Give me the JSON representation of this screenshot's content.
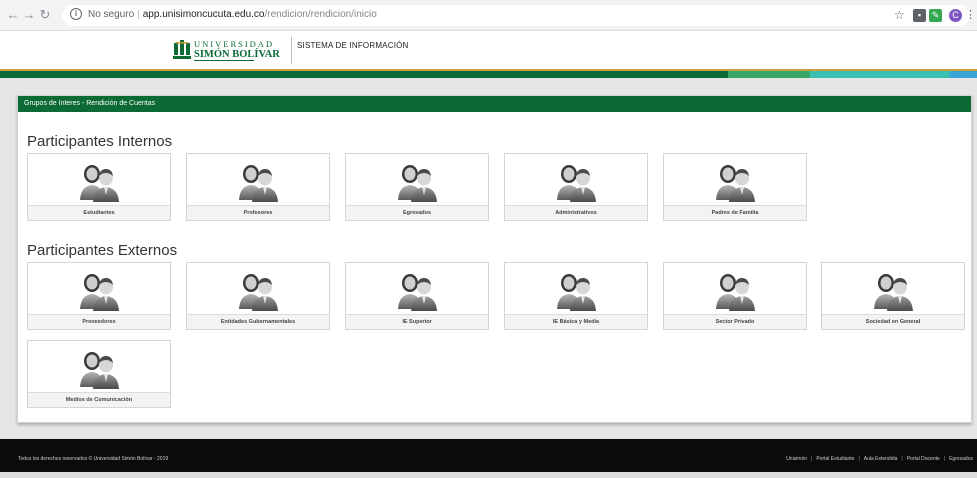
{
  "browser": {
    "security_label": "No seguro",
    "url_host": "app.unisimoncucuta.edu.co",
    "url_path": "/rendicion/rendicion/inicio"
  },
  "header": {
    "logo_line1": "UNIVERSIDAD",
    "logo_line2": "SIMÓN BOLÍVAR",
    "title": "SISTEMA DE INFORMACIÓN"
  },
  "panel": {
    "title": "Grupos de Interes - Rendición de Cuentas"
  },
  "internos": {
    "title": "Participantes Internos",
    "cards": [
      "Estudiantes",
      "Profesores",
      "Egresados",
      "Administrativos",
      "Padres de Familia"
    ]
  },
  "externos": {
    "title": "Participantes Externos",
    "cards": [
      "Proveedores",
      "Entidades Gubernamentales",
      "IE Superior",
      "IE Básica y Media",
      "Sector Privado",
      "Sociedad en General",
      "Medios de Comunicación"
    ]
  },
  "footer": {
    "copyright": "Todos los derechos reservados © Universidad Simón Bolívar - 2019",
    "links": [
      "Unisimón",
      "Portal Estudiante",
      "Aula Extendida",
      "Portal Docente",
      "Egresados"
    ]
  },
  "colors": {
    "brand_green": "#0c6a35",
    "gold": "#c8a13a"
  }
}
